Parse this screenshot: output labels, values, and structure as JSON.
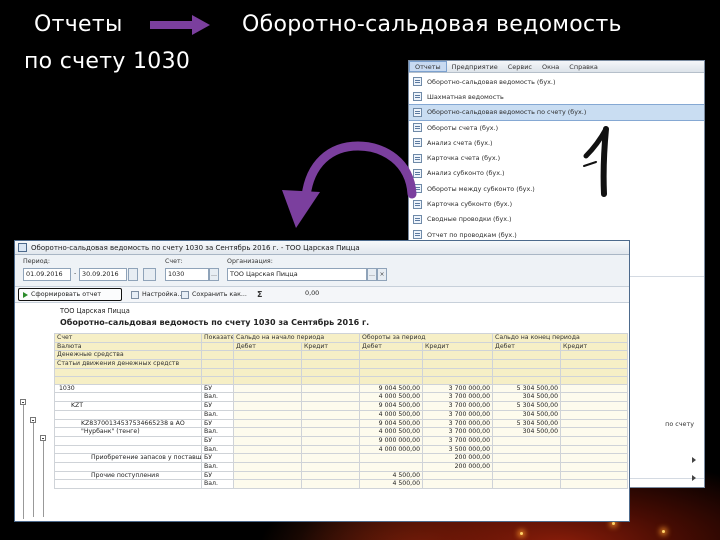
{
  "headings": {
    "reports": "Отчеты",
    "account": "по счету 1030",
    "osv": "Оборотно-сальдовая ведомость"
  },
  "colors": {
    "arrow": "#7b3f9e",
    "header_cells": "#f6efc6",
    "selected_menu": "#c9ddf2"
  },
  "menu": {
    "bar": [
      "Отчеты",
      "Предприятие",
      "Сервис",
      "Окна",
      "Справка"
    ],
    "items": [
      "Оборотно-сальдовая ведомость (бух.)",
      "Шахматная ведомость",
      "Оборотно-сальдовая ведомость по счету (бух.)",
      "Обороты счета (бух.)",
      "Анализ счета (бух.)",
      "Карточка счета (бух.)",
      "Анализ субконто (бух.)",
      "Обороты между субконто (бух.)",
      "Карточка субконто (бух.)",
      "Сводные проводки (бух.)",
      "Отчет по проводкам (бух.)"
    ],
    "selected_index": 2,
    "lower_text": "по счету"
  },
  "report": {
    "window_title": "Оборотно-сальдовая ведомость по счету 1030 за Сентябрь 2016 г. - ТОО Царская Пицца",
    "filters": {
      "period_label": "Период:",
      "period_from": "01.09.2016",
      "period_to": "30.09.2016",
      "account_label": "Счет:",
      "account": "1030",
      "org_label": "Организация:",
      "org": "ТОО Царская Пицца"
    },
    "toolbar": {
      "form_button": "Сформировать отчет",
      "settings_button": "Настройка...",
      "save_button": "Сохранить как...",
      "sum_value": "0,00"
    },
    "org_name": "ТОО Царская Пицца",
    "title": "Оборотно-сальдовая ведомость по счету 1030 за Сентябрь 2016 г.",
    "table": {
      "header1": [
        "Счет",
        "Показатели",
        "Сальдо на начало периода",
        "Обороты за период",
        "Сальдо на конец периода"
      ],
      "header_sub": [
        "Валюта",
        "Дебет",
        "Кредит",
        "Дебет",
        "Кредит",
        "Дебет",
        "Кредит"
      ],
      "header_extra": [
        "Денежные средства",
        "Статьи движения денежных средств"
      ],
      "rows": [
        {
          "acc": "1030",
          "ind": "БУ",
          "sd": "",
          "sc": "",
          "td": "9 004 500,00",
          "tc": "3 700 000,00",
          "ed": "5 304 500,00",
          "ec": ""
        },
        {
          "acc": "",
          "ind": "Вал.",
          "sd": "",
          "sc": "",
          "td": "4 000 500,00",
          "tc": "3 700 000,00",
          "ed": "304 500,00",
          "ec": ""
        },
        {
          "acc": "KZT",
          "ind": "БУ",
          "sd": "",
          "sc": "",
          "td": "9 004 500,00",
          "tc": "3 700 000,00",
          "ed": "5 304 500,00",
          "ec": ""
        },
        {
          "acc": "",
          "ind": "Вал.",
          "sd": "",
          "sc": "",
          "td": "4 000 500,00",
          "tc": "3 700 000,00",
          "ed": "304 500,00",
          "ec": ""
        },
        {
          "acc": "KZ83700134537534665238 в АО",
          "ind": "БУ",
          "sd": "",
          "sc": "",
          "td": "9 004 500,00",
          "tc": "3 700 000,00",
          "ed": "5 304 500,00",
          "ec": ""
        },
        {
          "acc": "\"Нурбанк\" (тенге)",
          "ind": "Вал.",
          "sd": "",
          "sc": "",
          "td": "4 000 500,00",
          "tc": "3 700 000,00",
          "ed": "304 500,00",
          "ec": ""
        },
        {
          "acc": "",
          "ind": "БУ",
          "sd": "",
          "sc": "",
          "td": "9 000 000,00",
          "tc": "3 700 000,00",
          "ed": "",
          "ec": ""
        },
        {
          "acc": "",
          "ind": "Вал.",
          "sd": "",
          "sc": "",
          "td": "4 000 000,00",
          "tc": "3 500 000,00",
          "ed": "",
          "ec": ""
        },
        {
          "acc": "Приобретение запасов у поставщиков",
          "ind": "БУ",
          "sd": "",
          "sc": "",
          "td": "",
          "tc": "200 000,00",
          "ed": "",
          "ec": ""
        },
        {
          "acc": "",
          "ind": "Вал.",
          "sd": "",
          "sc": "",
          "td": "",
          "tc": "200 000,00",
          "ed": "",
          "ec": ""
        },
        {
          "acc": "Прочие поступления",
          "ind": "БУ",
          "sd": "",
          "sc": "",
          "td": "4 500,00",
          "tc": "",
          "ed": "",
          "ec": ""
        },
        {
          "acc": "",
          "ind": "Вал.",
          "sd": "",
          "sc": "",
          "td": "4 500,00",
          "tc": "",
          "ed": "",
          "ec": ""
        }
      ]
    }
  }
}
